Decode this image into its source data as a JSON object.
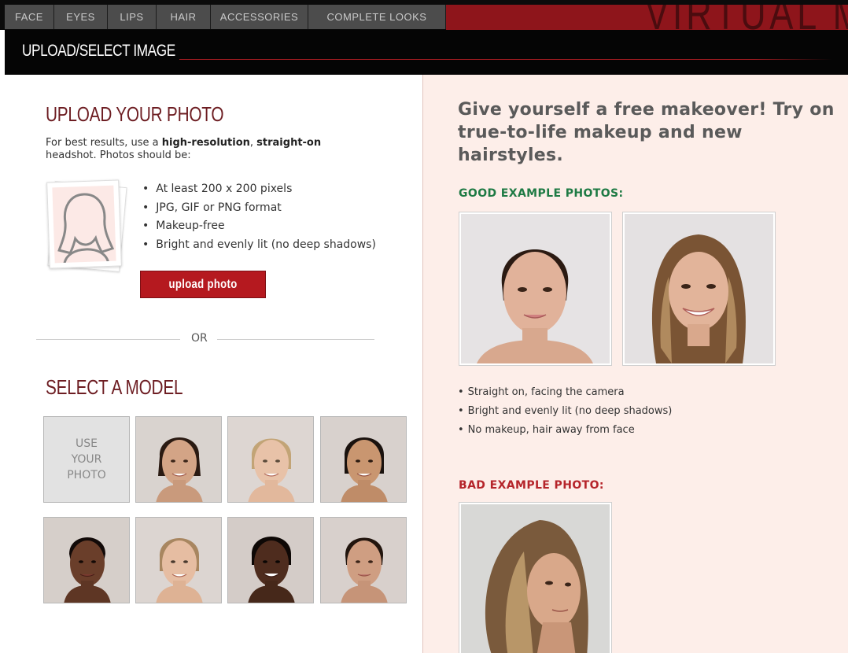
{
  "nav": {
    "tabs": [
      "FACE",
      "EYES",
      "LIPS",
      "HAIR",
      "ACCESSORIES",
      "COMPLETE LOOKS"
    ],
    "brand": "VIRTUAL M"
  },
  "page_title": "UPLOAD/SELECT IMAGE",
  "upload": {
    "heading": "UPLOAD YOUR PHOTO",
    "intro_1": "For best results, use a ",
    "intro_bold_1": "high-resolution",
    "intro_2": ", ",
    "intro_bold_2": "straight-on",
    "intro_3": " headshot. Photos should be:",
    "requirements": [
      "At least 200 x 200 pixels",
      "JPG, GIF or PNG format",
      "Makeup-free",
      "Bright and evenly lit (no deep shadows)"
    ],
    "button_label": "upload photo",
    "placeholder_icon": "avatar-silhouette-icon"
  },
  "divider_or": "OR",
  "models": {
    "heading": "SELECT A MODEL",
    "use_your_photo": "USE YOUR PHOTO"
  },
  "right": {
    "tagline": "Give yourself a free makeover! Try on true-to-life makeup and new hairstyles.",
    "good_heading": "GOOD EXAMPLE PHOTOS:",
    "tips": [
      "Straight on, facing the camera",
      "Bright and evenly lit (no deep shadows)",
      "No makeup, hair away from face"
    ],
    "bad_heading": "BAD EXAMPLE PHOTO:"
  },
  "colors": {
    "brand_red": "#8e151b",
    "heading_maroon": "#6d1d22",
    "good_green": "#1e7a44",
    "bad_red": "#b5242a",
    "panel_pink": "#fdeee9"
  }
}
